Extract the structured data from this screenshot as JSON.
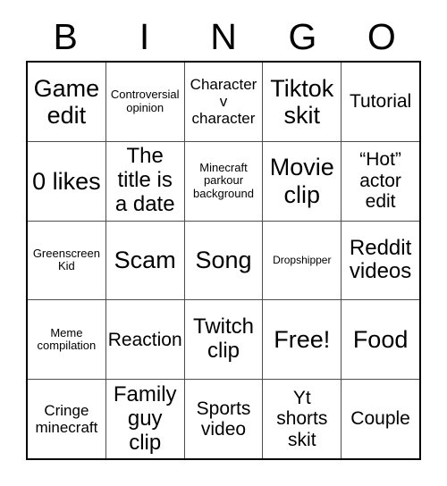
{
  "card": {
    "header_letters": [
      "B",
      "I",
      "N",
      "G",
      "O"
    ],
    "rows": [
      [
        {
          "text": "Game edit",
          "size": "t-xl"
        },
        {
          "text": "Controversial opinion",
          "size": "t-xs"
        },
        {
          "text": "Character v character",
          "size": "t-sm"
        },
        {
          "text": "Tiktok skit",
          "size": "t-xl"
        },
        {
          "text": "Tutorial",
          "size": "t-md"
        }
      ],
      [
        {
          "text": "0 likes",
          "size": "t-xl"
        },
        {
          "text": "The title is a date",
          "size": "t-lg"
        },
        {
          "text": "Minecraft parkour background",
          "size": "t-xs"
        },
        {
          "text": "Movie clip",
          "size": "t-xl"
        },
        {
          "text": "“Hot” actor edit",
          "size": "t-md"
        }
      ],
      [
        {
          "text": "Greenscreen Kid",
          "size": "t-xs"
        },
        {
          "text": "Scam",
          "size": "t-xl"
        },
        {
          "text": "Song",
          "size": "t-xl"
        },
        {
          "text": "Dropshipper",
          "size": "t-xxs"
        },
        {
          "text": "Reddit videos",
          "size": "t-lg"
        }
      ],
      [
        {
          "text": "Meme compilation",
          "size": "t-xs"
        },
        {
          "text": "Reaction",
          "size": "t-md"
        },
        {
          "text": "Twitch clip",
          "size": "t-lg"
        },
        {
          "text": "Free!",
          "size": "t-xl"
        },
        {
          "text": "Food",
          "size": "t-xl"
        }
      ],
      [
        {
          "text": "Cringe minecraft",
          "size": "t-sm"
        },
        {
          "text": "Family guy clip",
          "size": "t-lg"
        },
        {
          "text": "Sports video",
          "size": "t-md"
        },
        {
          "text": "Yt shorts skit",
          "size": "t-md"
        },
        {
          "text": "Couple",
          "size": "t-md"
        }
      ]
    ]
  },
  "colors": {
    "background": "#ffffff",
    "text": "#000000",
    "outer_border": "#000000",
    "inner_border": "#4d4d4d"
  }
}
